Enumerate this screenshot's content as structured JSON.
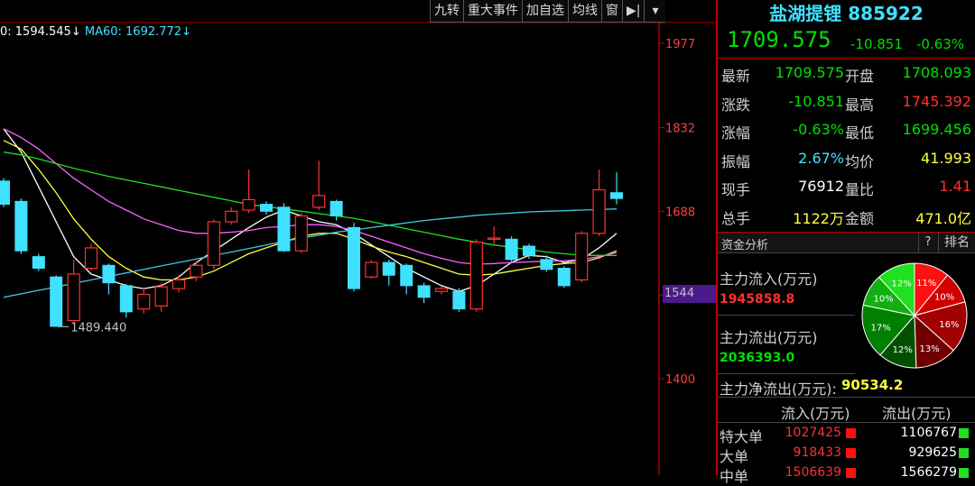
{
  "toolbar": {
    "items": [
      "九转",
      "重大事件",
      "加自选",
      "均线",
      "窗",
      "▶|",
      "▾"
    ]
  },
  "ma_legend": {
    "ma1": "0: 1594.545↓",
    "ma2": "MA60: 1692.772↓"
  },
  "price_axis": {
    "ticks": [
      "1977",
      "1832",
      "1688",
      "1544",
      "1400"
    ],
    "current": "1544"
  },
  "chart_data": {
    "type": "candlestick",
    "min_label": "1489.440",
    "candles": [
      {
        "o": 1740,
        "c": 1700,
        "h": 1745,
        "l": 1695
      },
      {
        "o": 1705,
        "c": 1620,
        "h": 1710,
        "l": 1615
      },
      {
        "o": 1610,
        "c": 1590,
        "h": 1615,
        "l": 1585
      },
      {
        "o": 1575,
        "c": 1490,
        "h": 1578,
        "l": 1489.44
      },
      {
        "o": 1500,
        "c": 1580,
        "h": 1605,
        "l": 1498
      },
      {
        "o": 1590,
        "c": 1625,
        "h": 1632,
        "l": 1586
      },
      {
        "o": 1595,
        "c": 1565,
        "h": 1598,
        "l": 1545
      },
      {
        "o": 1560,
        "c": 1515,
        "h": 1563,
        "l": 1505
      },
      {
        "o": 1520,
        "c": 1545,
        "h": 1556,
        "l": 1512
      },
      {
        "o": 1525,
        "c": 1558,
        "h": 1565,
        "l": 1515
      },
      {
        "o": 1555,
        "c": 1570,
        "h": 1578,
        "l": 1548
      },
      {
        "o": 1575,
        "c": 1595,
        "h": 1602,
        "l": 1568
      },
      {
        "o": 1595,
        "c": 1670,
        "h": 1674,
        "l": 1588
      },
      {
        "o": 1670,
        "c": 1688,
        "h": 1695,
        "l": 1665
      },
      {
        "o": 1690,
        "c": 1708,
        "h": 1760,
        "l": 1685
      },
      {
        "o": 1700,
        "c": 1688,
        "h": 1705,
        "l": 1682
      },
      {
        "o": 1695,
        "c": 1620,
        "h": 1702,
        "l": 1618
      },
      {
        "o": 1620,
        "c": 1680,
        "h": 1685,
        "l": 1616
      },
      {
        "o": 1695,
        "c": 1715,
        "h": 1775,
        "l": 1690
      },
      {
        "o": 1705,
        "c": 1680,
        "h": 1708,
        "l": 1672
      },
      {
        "o": 1660,
        "c": 1555,
        "h": 1668,
        "l": 1550
      },
      {
        "o": 1575,
        "c": 1600,
        "h": 1604,
        "l": 1572
      },
      {
        "o": 1600,
        "c": 1578,
        "h": 1605,
        "l": 1560
      },
      {
        "o": 1595,
        "c": 1560,
        "h": 1598,
        "l": 1545
      },
      {
        "o": 1560,
        "c": 1540,
        "h": 1565,
        "l": 1530
      },
      {
        "o": 1550,
        "c": 1555,
        "h": 1559,
        "l": 1545
      },
      {
        "o": 1550,
        "c": 1520,
        "h": 1556,
        "l": 1515
      },
      {
        "o": 1520,
        "c": 1635,
        "h": 1640,
        "l": 1515
      },
      {
        "o": 1640,
        "c": 1642,
        "h": 1662,
        "l": 1632
      },
      {
        "o": 1640,
        "c": 1605,
        "h": 1645,
        "l": 1600
      },
      {
        "o": 1628,
        "c": 1612,
        "h": 1632,
        "l": 1606
      },
      {
        "o": 1605,
        "c": 1588,
        "h": 1612,
        "l": 1584
      },
      {
        "o": 1590,
        "c": 1560,
        "h": 1594,
        "l": 1556
      },
      {
        "o": 1570,
        "c": 1650,
        "h": 1654,
        "l": 1566
      },
      {
        "o": 1650,
        "c": 1725,
        "h": 1760,
        "l": 1645
      },
      {
        "o": 1720,
        "c": 1710,
        "h": 1755,
        "l": 1700
      }
    ],
    "ma_lines": [
      {
        "name": "MA5",
        "color": "#ffffff",
        "points": [
          1830,
          1790,
          1730,
          1670,
          1610,
          1580,
          1570,
          1560,
          1555,
          1560,
          1575,
          1600,
          1620,
          1640,
          1660,
          1678,
          1690,
          1680,
          1670,
          1665,
          1650,
          1630,
          1610,
          1590,
          1575,
          1560,
          1550,
          1560,
          1580,
          1600,
          1612,
          1610,
          1600,
          1605,
          1625,
          1650
        ]
      },
      {
        "name": "MA10",
        "color": "#ffff40",
        "points": [
          1810,
          1795,
          1760,
          1720,
          1675,
          1640,
          1610,
          1590,
          1575,
          1570,
          1570,
          1575,
          1585,
          1600,
          1615,
          1625,
          1635,
          1645,
          1650,
          1650,
          1640,
          1628,
          1618,
          1610,
          1600,
          1590,
          1580,
          1578,
          1580,
          1585,
          1590,
          1595,
          1598,
          1600,
          1608,
          1620
        ]
      },
      {
        "name": "MA20",
        "color": "#ff60ff",
        "points": [
          1830,
          1815,
          1795,
          1770,
          1745,
          1725,
          1705,
          1690,
          1675,
          1665,
          1655,
          1650,
          1650,
          1652,
          1655,
          1660,
          1662,
          1665,
          1665,
          1662,
          1655,
          1645,
          1635,
          1625,
          1615,
          1607,
          1600,
          1597,
          1598,
          1600,
          1601,
          1602,
          1603,
          1605,
          1610,
          1617
        ]
      },
      {
        "name": "MA30",
        "color": "#20e020",
        "points": [
          1790,
          1785,
          1778,
          1770,
          1762,
          1755,
          1748,
          1742,
          1736,
          1730,
          1724,
          1718,
          1712,
          1706,
          1700,
          1696,
          1692,
          1688,
          1684,
          1680,
          1676,
          1670,
          1664,
          1658,
          1652,
          1646,
          1640,
          1635,
          1630,
          1626,
          1622,
          1618,
          1615,
          1612,
          1612,
          1612
        ]
      },
      {
        "name": "MA60",
        "color": "#40c8e0",
        "points": [
          1540,
          1546,
          1552,
          1558,
          1564,
          1570,
          1576,
          1582,
          1588,
          1594,
          1600,
          1606,
          1612,
          1618,
          1624,
          1630,
          1636,
          1642,
          1647,
          1652,
          1656,
          1660,
          1664,
          1668,
          1672,
          1675,
          1678,
          1681,
          1683,
          1685,
          1687,
          1688,
          1689,
          1690,
          1691,
          1692
        ]
      }
    ]
  },
  "quote": {
    "name": "盐湖提锂",
    "code": "885922",
    "price": "1709.575",
    "change": "-10.851",
    "change_pct": "-0.63%",
    "rows": [
      {
        "l1": "最新",
        "v1": "1709.575",
        "c1": "green",
        "l2": "开盘",
        "v2": "1708.093",
        "c2": "green"
      },
      {
        "l1": "涨跌",
        "v1": "-10.851",
        "c1": "green",
        "l2": "最高",
        "v2": "1745.392",
        "c2": "red"
      },
      {
        "l1": "涨幅",
        "v1": "-0.63%",
        "c1": "green",
        "l2": "最低",
        "v2": "1699.456",
        "c2": "green"
      },
      {
        "l1": "振幅",
        "v1": "2.67%",
        "c1": "cyan",
        "l2": "均价",
        "v2": "41.993",
        "c2": "yellow"
      },
      {
        "l1": "现手",
        "v1": "76912",
        "c1": "white",
        "l2": "量比",
        "v2": "1.41",
        "c2": "red"
      },
      {
        "l1": "总手",
        "v1": "1122万",
        "c1": "yellow",
        "l2": "金额",
        "v2": "471.0亿",
        "c2": "yellow"
      }
    ]
  },
  "fund": {
    "title": "资金分析",
    "help": "?",
    "rank": "排名",
    "inflow_label": "主力流入(万元)",
    "inflow_value": "1945858.8",
    "outflow_label": "主力流出(万元)",
    "outflow_value": "2036393.0",
    "net_label": "主力净流出(万元):",
    "net_value": "90534.2",
    "pie": [
      {
        "label": "11%",
        "value": 11,
        "color": "#ff1010"
      },
      {
        "label": "10%",
        "value": 10,
        "color": "#d00000"
      },
      {
        "label": "16%",
        "value": 16,
        "color": "#a00000"
      },
      {
        "label": "13%",
        "value": 13,
        "color": "#700000"
      },
      {
        "label": "12%",
        "value": 12,
        "color": "#005000"
      },
      {
        "label": "17%",
        "value": 17,
        "color": "#008000"
      },
      {
        "label": "10%",
        "value": 10,
        "color": "#10b010"
      },
      {
        "label": "12%",
        "value": 12,
        "color": "#20e020"
      }
    ],
    "table": {
      "col_in": "流入(万元)",
      "col_out": "流出(万元)",
      "rows": [
        {
          "name": "特大单",
          "in": "1027425",
          "out": "1106767"
        },
        {
          "name": "大单",
          "in": "918433",
          "out": "929625"
        },
        {
          "name": "中单",
          "in": "1506639",
          "out": "1566279"
        }
      ]
    }
  }
}
